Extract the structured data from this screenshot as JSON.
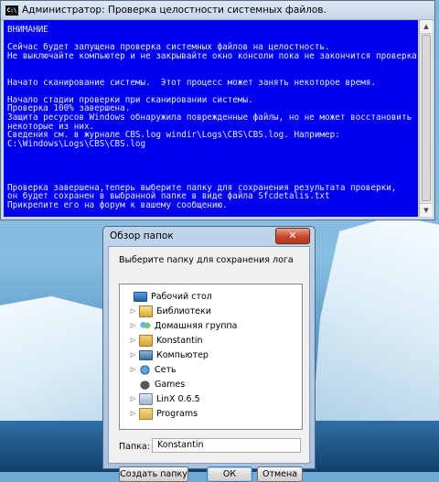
{
  "console": {
    "title": "Администратор:  Проверка целостности системных файлов.",
    "icon_label": "C:\\",
    "lines": [
      "ВНИМАНИЕ",
      "",
      "Сейчас будет запущена проверка системных файлов на целостность.",
      "Не выключайте компьютер и не закрывайте окно консоли пока не закончится проверка",
      "",
      "",
      "Начато сканирование системы.  Этот процесс может занять некоторое время.",
      "",
      "Начало стадии проверки при сканировании системы.",
      "Проверка 100% завершена.",
      "Защита ресурсов Windows обнаружила поврежденные файлы, но не может восстановить",
      "некоторые из них.",
      "Сведения см. в журнале CBS.log windir\\Logs\\CBS\\CBS.log. Например:",
      "C:\\Windows\\Logs\\CBS\\CBS.log",
      "",
      "",
      "",
      "",
      "Проверка завершена,теперь выберите папку для сохранения результата проверки,",
      "он будет сохранен в выбранной папке в виде файла Sfcdetalis.txt",
      "Прикрепите его на форум к вашему сообщению."
    ]
  },
  "dialog": {
    "title": "Обзор папок",
    "close_label": "✕",
    "prompt": "Выберите папку для сохранения лога",
    "tree": [
      {
        "label": "Рабочий стол",
        "icon": "desktop-icon",
        "expander": ""
      },
      {
        "label": "Библиотеки",
        "icon": "libraries-icon",
        "expander": "▷"
      },
      {
        "label": "Домашняя группа",
        "icon": "homegroup-icon",
        "expander": "▷"
      },
      {
        "label": "Konstantin",
        "icon": "user-folder-icon",
        "expander": "▷"
      },
      {
        "label": "Компьютер",
        "icon": "computer-icon",
        "expander": "▷"
      },
      {
        "label": "Сеть",
        "icon": "network-icon",
        "expander": "▷"
      },
      {
        "label": "Games",
        "icon": "games-icon",
        "expander": ""
      },
      {
        "label": "LinX 0.6.5",
        "icon": "linx-folder-icon",
        "expander": "▷"
      },
      {
        "label": "Programs",
        "icon": "programs-folder-icon",
        "expander": "▷"
      }
    ],
    "folder_label": "Папка:",
    "folder_value": "Konstantin",
    "buttons": {
      "new_folder": "Создать папку",
      "ok": "ОК",
      "cancel": "Отмена"
    }
  }
}
